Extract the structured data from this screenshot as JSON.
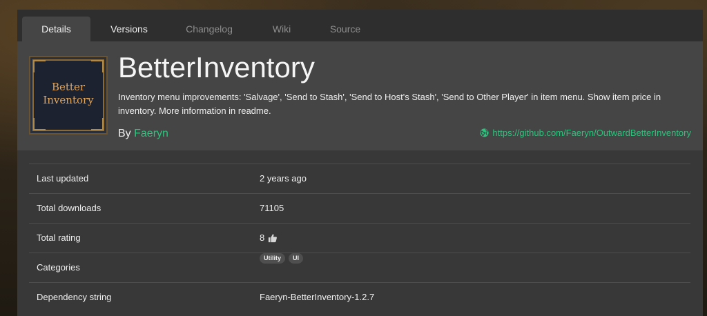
{
  "tabs": [
    {
      "label": "Details"
    },
    {
      "label": "Versions"
    },
    {
      "label": "Changelog"
    },
    {
      "label": "Wiki"
    },
    {
      "label": "Source"
    }
  ],
  "package": {
    "icon_text_line1": "Better",
    "icon_text_line2": "Inventory",
    "name": "BetterInventory",
    "description": "Inventory menu improvements: 'Salvage', 'Send to Stash', 'Send to Host's Stash', 'Send to Other Player' in item menu. Show item price in inventory. More information in readme.",
    "by_label": "By",
    "author": "Faeryn",
    "website": "https://github.com/Faeryn/OutwardBetterInventory",
    "website_icon": "globe-icon"
  },
  "details": {
    "rows": [
      {
        "label": "Last updated",
        "value": "2 years ago"
      },
      {
        "label": "Total downloads",
        "value": "71105"
      },
      {
        "label": "Total rating",
        "value": "8"
      },
      {
        "label": "Categories",
        "tags": [
          "Utility",
          "UI"
        ]
      },
      {
        "label": "Dependency string",
        "value": "Faeryn-BetterInventory-1.2.7"
      }
    ]
  },
  "colors": {
    "accent": "#2ec27e",
    "panel": "#383838",
    "header": "#454545"
  }
}
